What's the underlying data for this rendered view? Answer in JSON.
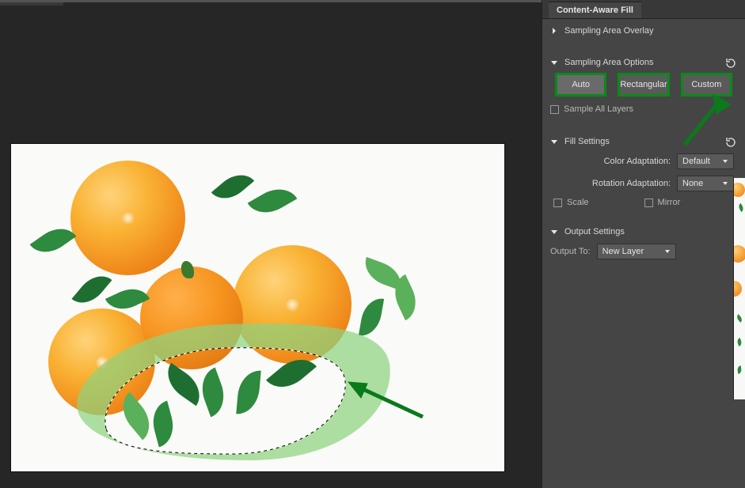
{
  "panel": {
    "title": "Content-Aware Fill",
    "sections": {
      "overlay": {
        "label": "Sampling Area Overlay"
      },
      "sampling": {
        "label": "Sampling Area Options",
        "modes": {
          "auto": "Auto",
          "rect": "Rectangular",
          "custom": "Custom"
        },
        "sample_all": "Sample All Layers"
      },
      "fill": {
        "label": "Fill Settings",
        "color_adapt_label": "Color Adaptation:",
        "color_adapt_value": "Default",
        "rotation_adapt_label": "Rotation Adaptation:",
        "rotation_adapt_value": "None",
        "scale": "Scale",
        "mirror": "Mirror"
      },
      "output": {
        "label": "Output Settings",
        "output_to_label": "Output To:",
        "output_to_value": "New Layer"
      }
    }
  }
}
